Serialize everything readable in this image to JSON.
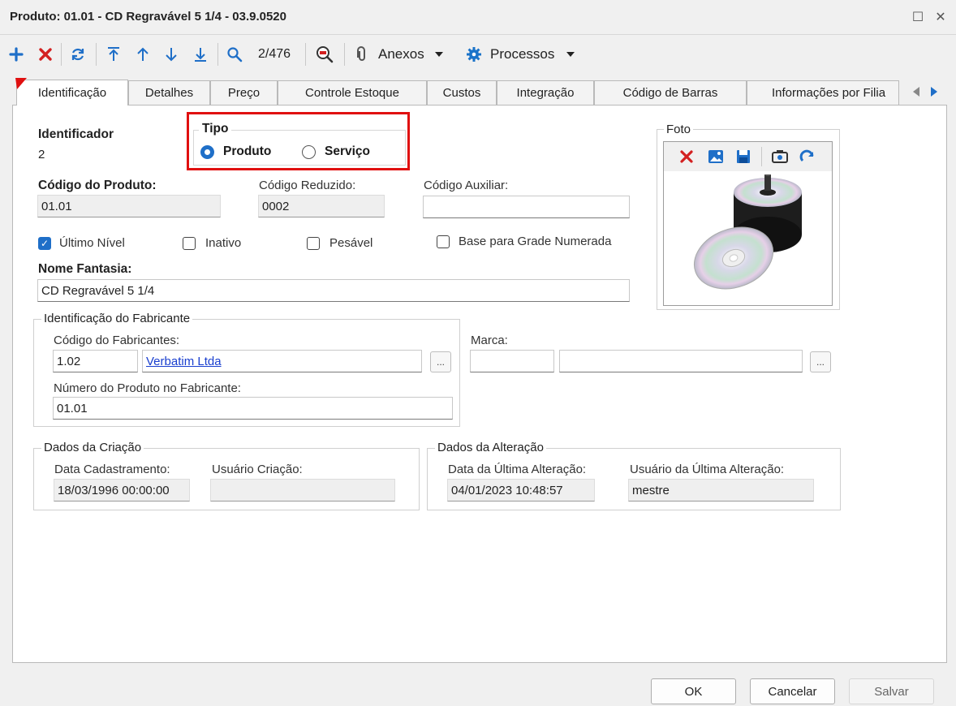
{
  "window": {
    "title": "Produto: 01.01 - CD Regravável 5 1/4 - 03.9.0520",
    "maximize_glyph": "☐",
    "close_glyph": "✕"
  },
  "toolbar": {
    "record_position": "2/476",
    "attachments_label": "Anexos",
    "processes_label": "Processos",
    "icons": [
      "add-icon",
      "delete-icon",
      "refresh-icon",
      "first-record-icon",
      "previous-record-icon",
      "next-record-icon",
      "last-record-icon",
      "search-icon",
      "sql-query-icon",
      "paperclip-icon",
      "gear-icon"
    ]
  },
  "tabs": [
    {
      "label": "Identificação",
      "active": true
    },
    {
      "label": "Detalhes"
    },
    {
      "label": "Preço"
    },
    {
      "label": "Controle Estoque"
    },
    {
      "label": "Custos"
    },
    {
      "label": "Integração"
    },
    {
      "label": "Código de Barras"
    },
    {
      "label": "Informações por Filia"
    }
  ],
  "form": {
    "identificador_label": "Identificador",
    "identificador_value": "2",
    "tipo": {
      "label": "Tipo",
      "options": [
        "Produto",
        "Serviço"
      ],
      "selected": "Produto"
    },
    "codigo_produto_label": "Código do Produto:",
    "codigo_produto_value": "01.01",
    "codigo_reduzido_label": "Código Reduzido:",
    "codigo_reduzido_value": "0002",
    "codigo_auxiliar_label": "Código Auxiliar:",
    "codigo_auxiliar_value": "",
    "checkboxes": [
      {
        "label": "Último Nível",
        "checked": true
      },
      {
        "label": "Inativo",
        "checked": false
      },
      {
        "label": "Pesável",
        "checked": false
      },
      {
        "label": "Base para Grade Numerada",
        "checked": false
      }
    ],
    "nome_fantasia_label": "Nome Fantasia:",
    "nome_fantasia_value": "CD Regravável 5 1/4",
    "foto_label": "Foto",
    "fabricante": {
      "group_label": "Identificação do Fabricante",
      "codigo_label": "Código do Fabricantes:",
      "codigo_value": "1.02",
      "nome_value": "Verbatim Ltda",
      "numero_label": "Número do Produto no Fabricante:",
      "numero_value": "01.01",
      "lookup_glyph": "..."
    },
    "marca": {
      "label": "Marca:",
      "code_value": "",
      "name_value": "",
      "lookup_glyph": "..."
    },
    "criacao": {
      "group_label": "Dados da Criação",
      "data_label": "Data Cadastramento:",
      "data_value": "18/03/1996 00:00:00",
      "usuario_label": "Usuário Criação:",
      "usuario_value": ""
    },
    "alteracao": {
      "group_label": "Dados da Alteração",
      "data_label": "Data da Última Alteração:",
      "data_value": "04/01/2023 10:48:57",
      "usuario_label": "Usuário da Última Alteração:",
      "usuario_value": "mestre"
    }
  },
  "buttons": {
    "ok": "OK",
    "cancel": "Cancelar",
    "save": "Salvar"
  },
  "colors": {
    "highlight_box": "#e01010",
    "accent_blue": "#1f6fc8",
    "delete_red": "#d32020",
    "link_blue": "#1a3fcf"
  }
}
